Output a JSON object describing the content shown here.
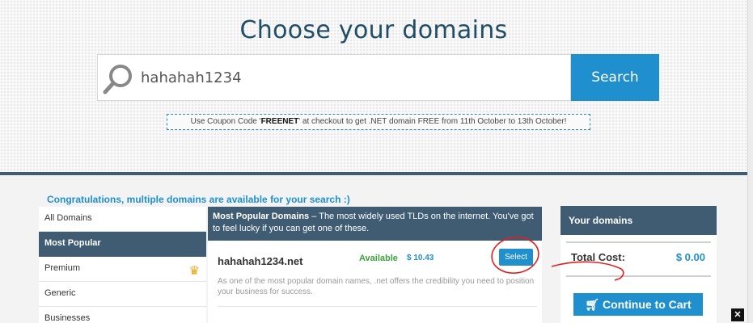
{
  "header": {
    "title": "Choose your domains"
  },
  "search": {
    "value": "hahahah1234",
    "button_label": "Search"
  },
  "coupon": {
    "prefix": "Use Coupon Code '",
    "code": "FREENET",
    "suffix": "' at checkout to get .NET domain FREE from 11th October to 13th October!"
  },
  "congrats": "Congratulations, multiple domains are available for your search :)",
  "categories": [
    {
      "label": "All Domains"
    },
    {
      "label": "Most Popular"
    },
    {
      "label": "Premium"
    },
    {
      "label": "Generic"
    },
    {
      "label": "Businesses"
    }
  ],
  "results": {
    "header_bold": "Most Popular Domains",
    "header_text": " – The most widely used TLDs on the internet. You've got to feel lucky if you can get one of these.",
    "item": {
      "domain": "hahahah1234.net",
      "status": "Available",
      "price": "$ 10.43",
      "select_label": "Select",
      "description": "As one of the most popular domain names, .net offers the credibility you need to position your business for success."
    }
  },
  "cart": {
    "title": "Your domains",
    "total_label": "Total Cost:",
    "total_value": "$ 0.00",
    "continue_label": "Continue to Cart"
  },
  "colors": {
    "accent": "#1f8fce",
    "navy": "#3f5c73",
    "available": "#3aa33a",
    "annotation": "#e02020"
  },
  "icons": {
    "search": "search-icon",
    "crown": "crown-icon",
    "cart": "cart-icon",
    "close": "close-icon"
  }
}
